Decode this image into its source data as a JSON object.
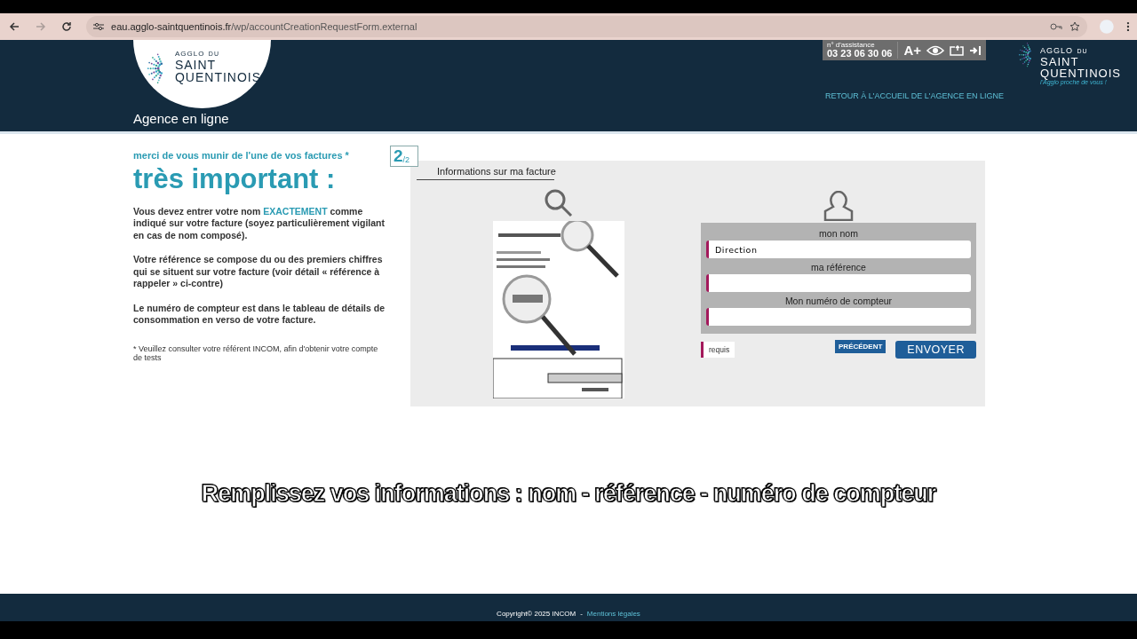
{
  "browser": {
    "url_host": "eau.agglo-saintquentinois.fr",
    "url_path": "/wp/accountCreationRequestForm.external",
    "forward_disabled": true
  },
  "header": {
    "logo": {
      "line1": "AGGLO",
      "small": "DU",
      "line2": "SAINT",
      "line3": "QUENTINOIS"
    },
    "site_title": "Agence en ligne",
    "assistance": {
      "label": "n° d'assistance",
      "phone": "03 23 06 30 06",
      "font_size_button": "A+"
    },
    "right_logo": {
      "line1": "AGGLO",
      "small": "DU",
      "line2": "SAINT",
      "line3": "QUENTINOIS",
      "tagline": "l'Agglo proche de vous !"
    },
    "back_link": "RETOUR À L'ACCUEIL DE L'AGENCE EN LIGNE"
  },
  "intro": {
    "lead": "merci de vous munir de l'une de vos factures *",
    "headline": "très important :",
    "paragraphs": [
      {
        "parts": [
          {
            "text": "Vous devez entrer votre nom ",
            "highlight": false
          },
          {
            "text": "EXACTEMENT",
            "highlight": true
          },
          {
            "text": " comme indiqué sur votre facture (soyez particulièrement vigilant en cas de nom composé).",
            "highlight": false
          }
        ]
      },
      {
        "parts": [
          {
            "text": "Votre référence se compose du ou des premiers chiffres qui se situent sur votre facture (voir détail « référence à rappeler » ci-contre)",
            "highlight": false
          }
        ]
      },
      {
        "parts": [
          {
            "text": "Le numéro de compteur est dans le tableau de détails de consommation en verso de votre facture.",
            "highlight": false
          }
        ]
      }
    ],
    "note": "* Veuillez consulter votre référent INCOM, afin d'obtenir votre compte de tests"
  },
  "step": {
    "current": "2",
    "total": "/2"
  },
  "panel": {
    "title": "Informations sur ma facture",
    "fields": [
      {
        "label": "mon nom",
        "value": "Direction",
        "required": true
      },
      {
        "label": "ma référence",
        "required": true
      },
      {
        "label": "Mon numéro de compteur",
        "required": true
      }
    ],
    "required_legend": "requis",
    "buttons": [
      {
        "label": "PRÉCÉDENT",
        "kind": "secondary"
      },
      {
        "label": "ENVOYER",
        "kind": "primary"
      }
    ]
  },
  "subtitle": "Remplissez vos informations : nom - référence - numéro de compteur",
  "footer": {
    "copyright": "Copyright© 2025 INCOM",
    "separator": "-",
    "legal_link": "Mentions légales"
  }
}
